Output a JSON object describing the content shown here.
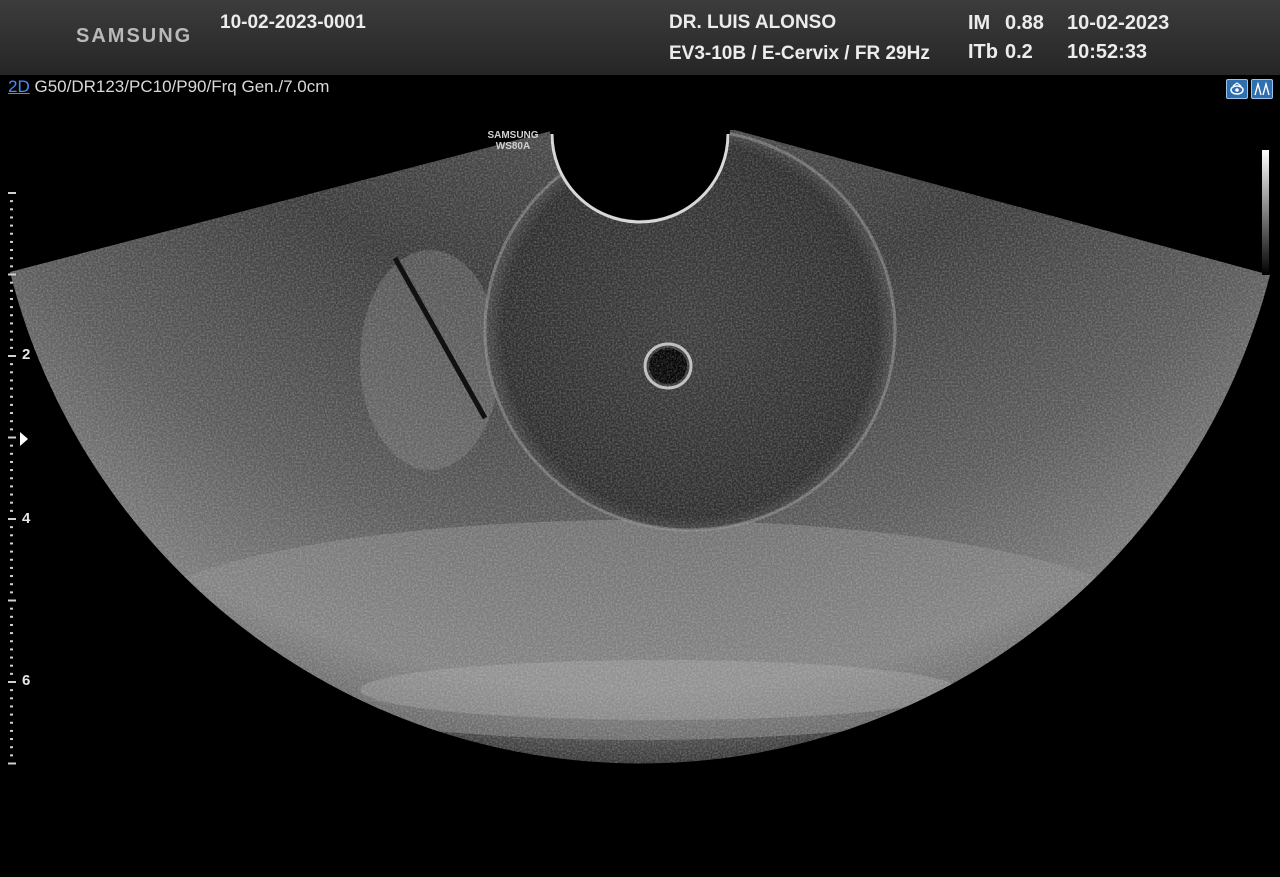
{
  "header": {
    "brand": "SAMSUNG",
    "patient_id": "10-02-2023-0001",
    "physician": "DR. LUIS ALONSO",
    "probe_preset": "EV3-10B / E-Cervix / FR 29Hz",
    "im_label": "IM",
    "im_value": "0.88",
    "itb_label": "ITb",
    "itb_value": "0.2",
    "date": "10-02-2023",
    "time": "10:52:33"
  },
  "params": {
    "mode": "2D",
    "items": [
      "G50",
      "DR123",
      "PC10",
      "P90",
      "Frq Gen.",
      "7.0cm"
    ]
  },
  "watermark": {
    "line1": "SAMSUNG",
    "line2": "WS80A"
  },
  "depth_scale": {
    "labels": [
      "2",
      "4",
      "6"
    ],
    "unit_max_cm": 7.0
  },
  "icons": [
    "probe-view-icon",
    "dual-view-icon"
  ],
  "colors": {
    "mode_link": "#4a8cff",
    "header_bg": "#333333",
    "icon_bg": "#2f6fb0"
  }
}
